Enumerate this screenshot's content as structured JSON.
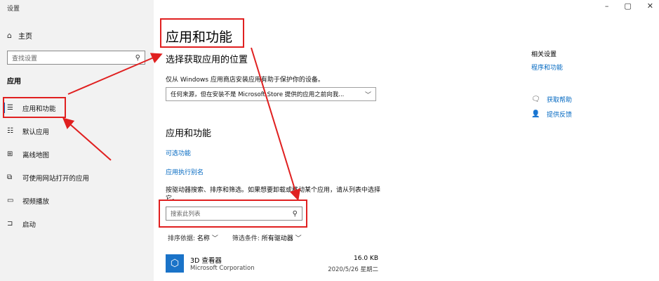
{
  "window": {
    "title": "设置",
    "controls": {
      "minimize": "–",
      "maximize": "▢",
      "close": "✕"
    }
  },
  "sidebar": {
    "home_label": "主页",
    "search_placeholder": "查找设置",
    "section_label": "应用",
    "items": [
      {
        "label": "应用和功能",
        "icon": "list-icon",
        "active": true
      },
      {
        "label": "默认应用",
        "icon": "default-apps-icon",
        "active": false
      },
      {
        "label": "离线地图",
        "icon": "map-icon",
        "active": false
      },
      {
        "label": "可使用网站打开的应用",
        "icon": "website-apps-icon",
        "active": false
      },
      {
        "label": "视频播放",
        "icon": "video-icon",
        "active": false
      },
      {
        "label": "启动",
        "icon": "startup-icon",
        "active": false
      }
    ]
  },
  "main": {
    "title": "应用和功能",
    "install_section": {
      "heading": "选择获取应用的位置",
      "description": "仅从 Windows 应用商店安装应用有助于保护你的设备。",
      "dropdown_value": "任何来源，但在安装不是 Microsoft Store 提供的应用之前向我..."
    },
    "apps_section": {
      "heading": "应用和功能",
      "link_optional": "可选功能",
      "link_alias": "应用执行别名",
      "search_hint": "按驱动器搜索、排序和筛选。如果想要卸载或移动某个应用，请从列表中选择它。",
      "search_placeholder": "搜索此列表",
      "sort_label": "排序依据:",
      "sort_value": "名称",
      "filter_label": "筛选条件:",
      "filter_value": "所有驱动器"
    },
    "apps": [
      {
        "name": "3D 查看器",
        "publisher": "Microsoft Corporation",
        "size": "16.0 KB",
        "date": "2020/5/26 星期二"
      }
    ]
  },
  "related": {
    "title": "相关设置",
    "link": "程序和功能",
    "help_label": "获取帮助",
    "feedback_label": "提供反馈"
  },
  "colors": {
    "accent": "#0067c0",
    "annotation": "#e02020"
  }
}
